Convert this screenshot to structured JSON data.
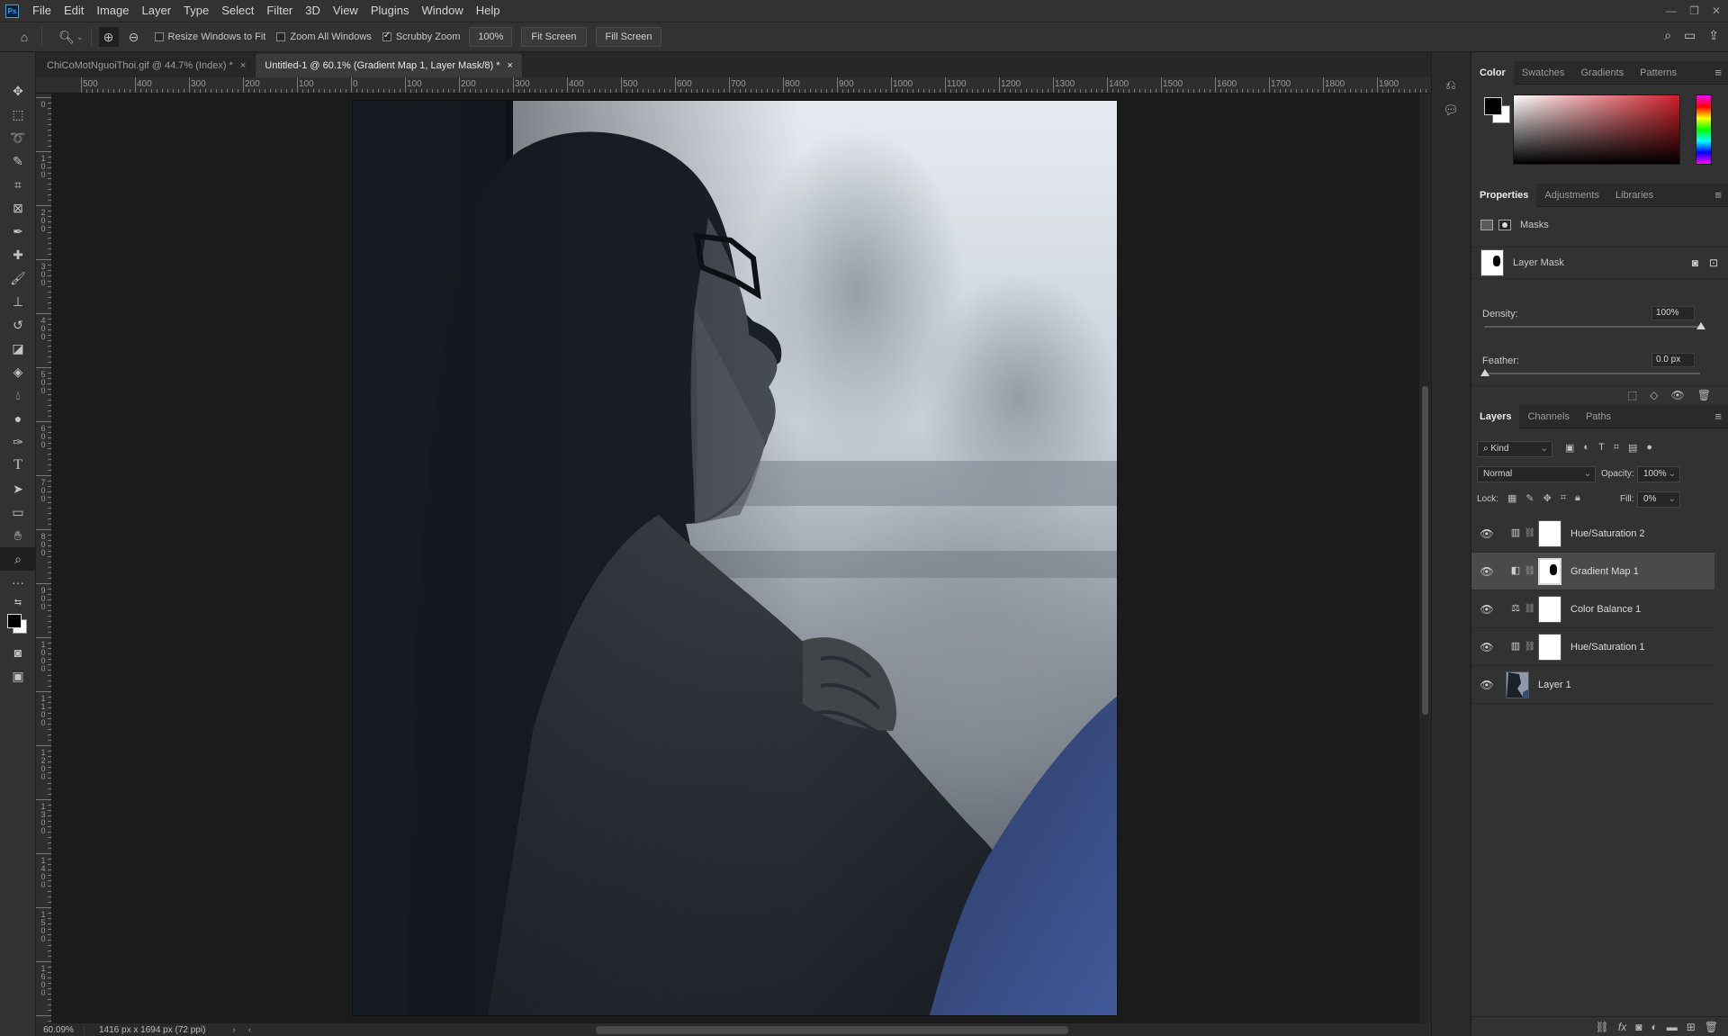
{
  "app": {
    "logo": "Ps"
  },
  "menu": [
    "File",
    "Edit",
    "Image",
    "Layer",
    "Type",
    "Select",
    "Filter",
    "3D",
    "View",
    "Plugins",
    "Window",
    "Help"
  ],
  "window_controls": [
    "minimize-icon",
    "restore-icon",
    "close-icon"
  ],
  "options": {
    "resize_windows": {
      "label": "Resize Windows to Fit",
      "checked": false
    },
    "zoom_all": {
      "label": "Zoom All Windows",
      "checked": false
    },
    "scrubby_zoom": {
      "label": "Scrubby Zoom",
      "checked": true
    },
    "zoom_value": "100%",
    "fit_screen": "Fit Screen",
    "fill_screen": "Fill Screen"
  },
  "tabs": [
    {
      "label": "ChiCoMotNguoiThoi.gif @ 44.7% (Index) *",
      "active": false
    },
    {
      "label": "Untitled-1 @ 60.1% (Gradient Map 1, Layer Mask/8) *",
      "active": true
    }
  ],
  "ruler_h": [
    "500",
    "400",
    "300",
    "200",
    "100",
    "0",
    "100",
    "200",
    "300",
    "400",
    "500",
    "600",
    "700",
    "800",
    "900",
    "1000",
    "1100",
    "1200",
    "1300",
    "1400",
    "1500",
    "1600",
    "1700",
    "1800",
    "1900"
  ],
  "ruler_v": [
    "0",
    "1\n0\n0",
    "2\n0\n0",
    "3\n0\n0",
    "4\n0\n0",
    "5\n0\n0",
    "6\n0\n0",
    "7\n0\n0",
    "8\n0\n0",
    "9\n0\n0",
    "1\n0\n0\n0",
    "1\n1\n0\n0",
    "1\n2\n0\n0",
    "1\n3\n0\n0",
    "1\n4\n0\n0",
    "1\n5\n0\n0",
    "1\n6\n0\n0"
  ],
  "status": {
    "zoom": "60.09%",
    "doc_info": "1416 px x 1694 px (72 ppi)"
  },
  "color_panel": {
    "tabs": [
      "Color",
      "Swatches",
      "Gradients",
      "Patterns"
    ],
    "fg": "#000000",
    "bg": "#ffffff",
    "hue_color": "#cf1f28"
  },
  "properties": {
    "tabs": [
      "Properties",
      "Adjustments",
      "Libraries"
    ],
    "section": "Masks",
    "mask_label": "Layer Mask",
    "density_label": "Density:",
    "density_value": "100%",
    "feather_label": "Feather:",
    "feather_value": "0.0 px"
  },
  "layers_panel": {
    "tabs": [
      "Layers",
      "Channels",
      "Paths"
    ],
    "filter_kind": "Kind",
    "blend_mode": "Normal",
    "opacity_label": "Opacity:",
    "opacity_value": "100%",
    "lock_label": "Lock:",
    "fill_label": "Fill:",
    "fill_value": "0%",
    "layers": [
      {
        "name": "Hue/Saturation 2",
        "icon": "hue-saturation-icon",
        "selected": false
      },
      {
        "name": "Gradient Map 1",
        "icon": "gradient-map-icon",
        "selected": true
      },
      {
        "name": "Color Balance 1",
        "icon": "color-balance-icon",
        "selected": false
      },
      {
        "name": "Hue/Saturation 1",
        "icon": "hue-saturation-icon",
        "selected": false
      },
      {
        "name": "Layer 1",
        "icon": "image-thumb",
        "selected": false
      }
    ]
  }
}
